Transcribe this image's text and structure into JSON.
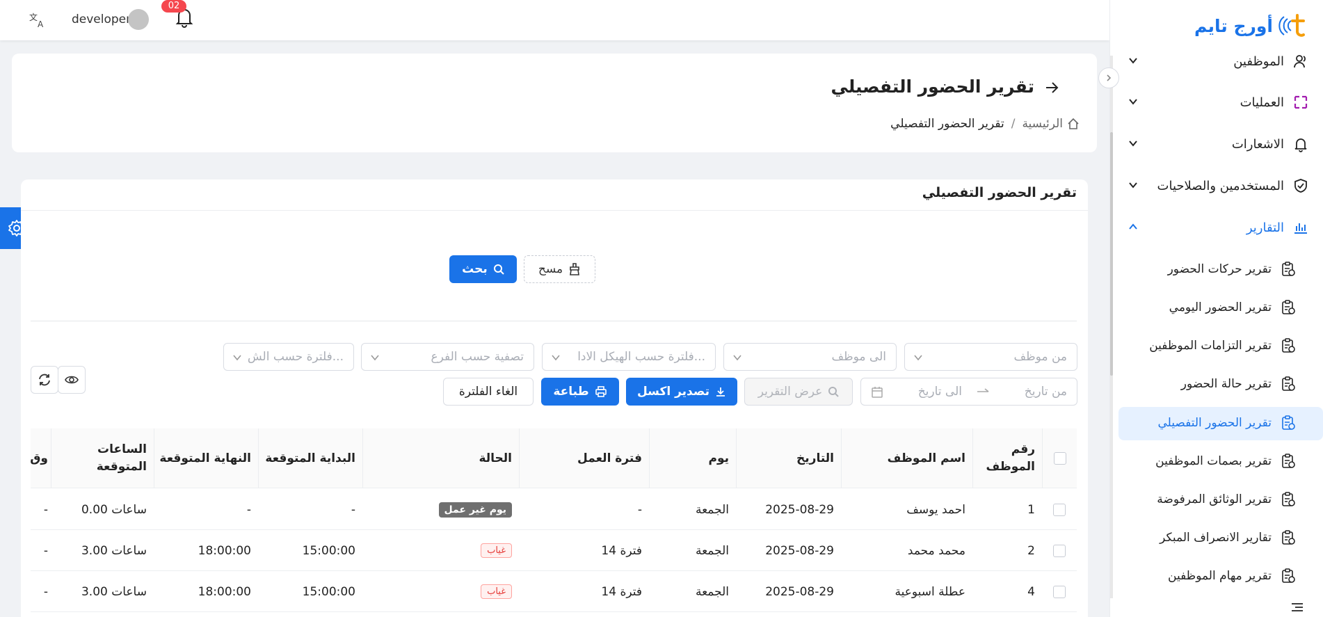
{
  "header": {
    "translate_icon": "translate-icon",
    "username": "developer",
    "notification_count": "02"
  },
  "sidebar": {
    "logo_text": "أورج تايم",
    "menu": [
      {
        "label": "الموظفين",
        "icon": "employees-icon"
      },
      {
        "label": "العمليات",
        "icon": "operations-icon"
      },
      {
        "label": "الاشعارات",
        "icon": "bell-icon"
      },
      {
        "label": "المستخدمين والصلاحيات",
        "icon": "shield-icon"
      },
      {
        "label": "التقارير",
        "icon": "reports-icon"
      }
    ],
    "reports_sub": [
      "تقرير حركات الحضور",
      "تقرير الحضور اليومي",
      "تقرير التزامات الموظفين",
      "تقرير حالة الحضور",
      "تقرير الحضور التفصيلي",
      "تقرير بصمات الموظفين",
      "تقرير الوثائق المرفوضة",
      "تقارير الانصراف المبكر",
      "تقرير مهام الموظفين"
    ]
  },
  "page": {
    "title": "تقرير الحضور التفصيلي",
    "breadcrumb_home": "الرئيسية",
    "breadcrumb_sep": "/",
    "breadcrumb_current": "تقرير الحضور التفصيلي"
  },
  "report": {
    "card_title": "تقرير الحضور التفصيلي",
    "search_button": "بحث",
    "clear_button": "مسح"
  },
  "filters": {
    "from_employee": "من موظف",
    "to_employee": "الى موظف",
    "by_admin_structure": "فلترة حسب الهيكل الادا...",
    "by_branch": "تصفية حسب الفرع",
    "by_shift": "فلترة حسب الش...",
    "from_date": "من تاريخ",
    "to_date": "الى تاريخ",
    "view_report": "عرض التقرير",
    "export_excel": "تصدير اكسل",
    "print": "طباعة",
    "cancel_filter": "الغاء الفلترة"
  },
  "table": {
    "columns": [
      "رقم الموظف",
      "اسم الموظف",
      "التاريخ",
      "يوم",
      "فترة العمل",
      "الحالة",
      "البداية المتوقعة",
      "النهاية المتوقعة",
      "الساعات المتوقعة",
      "وق الف"
    ],
    "rows": [
      {
        "id": "1",
        "name": "احمد يوسف",
        "date": "2025-08-29",
        "day": "الجمعة",
        "shift": "-",
        "status": "يوم غير عمل",
        "status_type": "nonwork",
        "start": "-",
        "end": "-",
        "hours": "0.00 ساعات",
        "extra": "-"
      },
      {
        "id": "2",
        "name": "محمد محمد",
        "date": "2025-08-29",
        "day": "الجمعة",
        "shift": "فترة 14",
        "status": "غياب",
        "status_type": "absent",
        "start": "15:00:00",
        "end": "18:00:00",
        "hours": "3.00 ساعات",
        "extra": "-"
      },
      {
        "id": "4",
        "name": "عطلة اسبوعية",
        "date": "2025-08-29",
        "day": "الجمعة",
        "shift": "فترة 14",
        "status": "غياب",
        "status_type": "absent",
        "start": "15:00:00",
        "end": "18:00:00",
        "hours": "3.00 ساعات",
        "extra": "-"
      }
    ]
  },
  "colors": {
    "primary": "#1a73e8",
    "badge": "#f5474e",
    "absent": "#e53935",
    "nonwork_tag": "#6f6f6f"
  }
}
